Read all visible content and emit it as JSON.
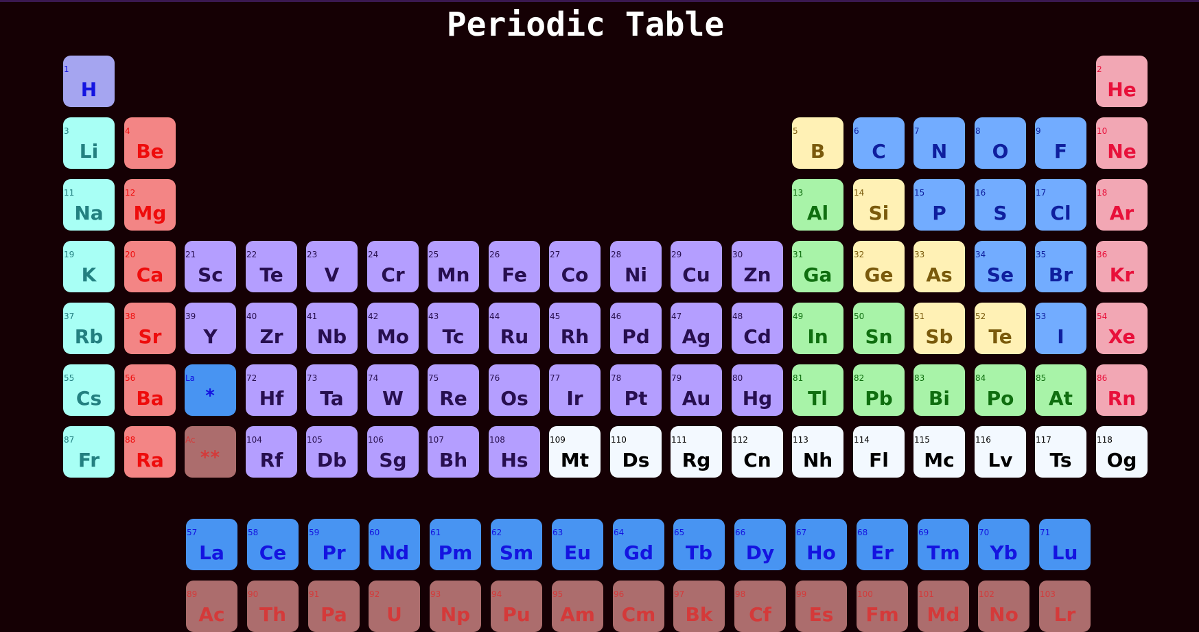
{
  "title": "Periodic Table",
  "colors": {
    "background": "#150004",
    "hydrogen": "#a5a5f0",
    "alkali_metal": "#a8fff5",
    "alkaline_earth": "#f38585",
    "noble_gas": "#f2a7b4",
    "transition_metal": "#b49eff",
    "post_transition_metal": "#a8f3a8",
    "metalloid": "#fff1b5",
    "nonmetal": "#72acff",
    "lanthanide": "#4894f2",
    "actinide": "#ac6d6d",
    "unknown": "#f3f9ff"
  },
  "elements": [
    {
      "n": "1",
      "s": "H",
      "c": "c-H",
      "g": 1,
      "r": 1
    },
    {
      "n": "2",
      "s": "He",
      "c": "c-ng",
      "g": 18,
      "r": 1
    },
    {
      "n": "3",
      "s": "Li",
      "c": "c-alk",
      "g": 1,
      "r": 2
    },
    {
      "n": "4",
      "s": "Be",
      "c": "c-ae",
      "g": 2,
      "r": 2
    },
    {
      "n": "5",
      "s": "B",
      "c": "c-mld",
      "g": 13,
      "r": 2
    },
    {
      "n": "6",
      "s": "C",
      "c": "c-nm",
      "g": 14,
      "r": 2
    },
    {
      "n": "7",
      "s": "N",
      "c": "c-nm",
      "g": 15,
      "r": 2
    },
    {
      "n": "8",
      "s": "O",
      "c": "c-nm",
      "g": 16,
      "r": 2
    },
    {
      "n": "9",
      "s": "F",
      "c": "c-nm",
      "g": 17,
      "r": 2
    },
    {
      "n": "10",
      "s": "Ne",
      "c": "c-ng",
      "g": 18,
      "r": 2
    },
    {
      "n": "11",
      "s": "Na",
      "c": "c-alk",
      "g": 1,
      "r": 3
    },
    {
      "n": "12",
      "s": "Mg",
      "c": "c-ae",
      "g": 2,
      "r": 3
    },
    {
      "n": "13",
      "s": "Al",
      "c": "c-met",
      "g": 13,
      "r": 3
    },
    {
      "n": "14",
      "s": "Si",
      "c": "c-mld",
      "g": 14,
      "r": 3
    },
    {
      "n": "15",
      "s": "P",
      "c": "c-nm",
      "g": 15,
      "r": 3
    },
    {
      "n": "16",
      "s": "S",
      "c": "c-nm",
      "g": 16,
      "r": 3
    },
    {
      "n": "17",
      "s": "Cl",
      "c": "c-nm",
      "g": 17,
      "r": 3
    },
    {
      "n": "18",
      "s": "Ar",
      "c": "c-ng",
      "g": 18,
      "r": 3
    },
    {
      "n": "19",
      "s": "K",
      "c": "c-alk",
      "g": 1,
      "r": 4
    },
    {
      "n": "20",
      "s": "Ca",
      "c": "c-ae",
      "g": 2,
      "r": 4
    },
    {
      "n": "21",
      "s": "Sc",
      "c": "c-tm",
      "g": 3,
      "r": 4
    },
    {
      "n": "22",
      "s": "Te",
      "c": "c-tm",
      "g": 4,
      "r": 4
    },
    {
      "n": "23",
      "s": "V",
      "c": "c-tm",
      "g": 5,
      "r": 4
    },
    {
      "n": "24",
      "s": "Cr",
      "c": "c-tm",
      "g": 6,
      "r": 4
    },
    {
      "n": "25",
      "s": "Mn",
      "c": "c-tm",
      "g": 7,
      "r": 4
    },
    {
      "n": "26",
      "s": "Fe",
      "c": "c-tm",
      "g": 8,
      "r": 4
    },
    {
      "n": "27",
      "s": "Co",
      "c": "c-tm",
      "g": 9,
      "r": 4
    },
    {
      "n": "28",
      "s": "Ni",
      "c": "c-tm",
      "g": 10,
      "r": 4
    },
    {
      "n": "29",
      "s": "Cu",
      "c": "c-tm",
      "g": 11,
      "r": 4
    },
    {
      "n": "30",
      "s": "Zn",
      "c": "c-tm",
      "g": 12,
      "r": 4
    },
    {
      "n": "31",
      "s": "Ga",
      "c": "c-met",
      "g": 13,
      "r": 4
    },
    {
      "n": "32",
      "s": "Ge",
      "c": "c-mld",
      "g": 14,
      "r": 4
    },
    {
      "n": "33",
      "s": "As",
      "c": "c-mld",
      "g": 15,
      "r": 4
    },
    {
      "n": "34",
      "s": "Se",
      "c": "c-nm",
      "g": 16,
      "r": 4
    },
    {
      "n": "35",
      "s": "Br",
      "c": "c-nm",
      "g": 17,
      "r": 4
    },
    {
      "n": "36",
      "s": "Kr",
      "c": "c-ng",
      "g": 18,
      "r": 4
    },
    {
      "n": "37",
      "s": "Rb",
      "c": "c-alk",
      "g": 1,
      "r": 5
    },
    {
      "n": "38",
      "s": "Sr",
      "c": "c-ae",
      "g": 2,
      "r": 5
    },
    {
      "n": "39",
      "s": "Y",
      "c": "c-tm",
      "g": 3,
      "r": 5
    },
    {
      "n": "40",
      "s": "Zr",
      "c": "c-tm",
      "g": 4,
      "r": 5
    },
    {
      "n": "41",
      "s": "Nb",
      "c": "c-tm",
      "g": 5,
      "r": 5
    },
    {
      "n": "42",
      "s": "Mo",
      "c": "c-tm",
      "g": 6,
      "r": 5
    },
    {
      "n": "43",
      "s": "Tc",
      "c": "c-tm",
      "g": 7,
      "r": 5
    },
    {
      "n": "44",
      "s": "Ru",
      "c": "c-tm",
      "g": 8,
      "r": 5
    },
    {
      "n": "45",
      "s": "Rh",
      "c": "c-tm",
      "g": 9,
      "r": 5
    },
    {
      "n": "46",
      "s": "Pd",
      "c": "c-tm",
      "g": 10,
      "r": 5
    },
    {
      "n": "47",
      "s": "Ag",
      "c": "c-tm",
      "g": 11,
      "r": 5
    },
    {
      "n": "48",
      "s": "Cd",
      "c": "c-tm",
      "g": 12,
      "r": 5
    },
    {
      "n": "49",
      "s": "In",
      "c": "c-met",
      "g": 13,
      "r": 5
    },
    {
      "n": "50",
      "s": "Sn",
      "c": "c-met",
      "g": 14,
      "r": 5
    },
    {
      "n": "51",
      "s": "Sb",
      "c": "c-mld",
      "g": 15,
      "r": 5
    },
    {
      "n": "52",
      "s": "Te",
      "c": "c-mld",
      "g": 16,
      "r": 5
    },
    {
      "n": "53",
      "s": "I",
      "c": "c-nm",
      "g": 17,
      "r": 5
    },
    {
      "n": "54",
      "s": "Xe",
      "c": "c-ng",
      "g": 18,
      "r": 5
    },
    {
      "n": "55",
      "s": "Cs",
      "c": "c-alk",
      "g": 1,
      "r": 6
    },
    {
      "n": "56",
      "s": "Ba",
      "c": "c-ae",
      "g": 2,
      "r": 6
    },
    {
      "n": "La",
      "s": "*",
      "c": "c-lan",
      "g": 3,
      "r": 6,
      "star": true
    },
    {
      "n": "72",
      "s": "Hf",
      "c": "c-tm",
      "g": 4,
      "r": 6
    },
    {
      "n": "73",
      "s": "Ta",
      "c": "c-tm",
      "g": 5,
      "r": 6
    },
    {
      "n": "74",
      "s": "W",
      "c": "c-tm",
      "g": 6,
      "r": 6
    },
    {
      "n": "75",
      "s": "Re",
      "c": "c-tm",
      "g": 7,
      "r": 6
    },
    {
      "n": "76",
      "s": "Os",
      "c": "c-tm",
      "g": 8,
      "r": 6
    },
    {
      "n": "77",
      "s": "Ir",
      "c": "c-tm",
      "g": 9,
      "r": 6
    },
    {
      "n": "78",
      "s": "Pt",
      "c": "c-tm",
      "g": 10,
      "r": 6
    },
    {
      "n": "79",
      "s": "Au",
      "c": "c-tm",
      "g": 11,
      "r": 6
    },
    {
      "n": "80",
      "s": "Hg",
      "c": "c-tm",
      "g": 12,
      "r": 6
    },
    {
      "n": "81",
      "s": "Tl",
      "c": "c-met",
      "g": 13,
      "r": 6
    },
    {
      "n": "82",
      "s": "Pb",
      "c": "c-met",
      "g": 14,
      "r": 6
    },
    {
      "n": "83",
      "s": "Bi",
      "c": "c-met",
      "g": 15,
      "r": 6
    },
    {
      "n": "84",
      "s": "Po",
      "c": "c-met",
      "g": 16,
      "r": 6
    },
    {
      "n": "85",
      "s": "At",
      "c": "c-met",
      "g": 17,
      "r": 6
    },
    {
      "n": "86",
      "s": "Rn",
      "c": "c-ng",
      "g": 18,
      "r": 6
    },
    {
      "n": "87",
      "s": "Fr",
      "c": "c-alk",
      "g": 1,
      "r": 7
    },
    {
      "n": "88",
      "s": "Ra",
      "c": "c-ae",
      "g": 2,
      "r": 7
    },
    {
      "n": "Ac",
      "s": "**",
      "c": "c-act",
      "g": 3,
      "r": 7,
      "star": true
    },
    {
      "n": "104",
      "s": "Rf",
      "c": "c-tm",
      "g": 4,
      "r": 7
    },
    {
      "n": "105",
      "s": "Db",
      "c": "c-tm",
      "g": 5,
      "r": 7
    },
    {
      "n": "106",
      "s": "Sg",
      "c": "c-tm",
      "g": 6,
      "r": 7
    },
    {
      "n": "107",
      "s": "Bh",
      "c": "c-tm",
      "g": 7,
      "r": 7
    },
    {
      "n": "108",
      "s": "Hs",
      "c": "c-tm",
      "g": 8,
      "r": 7
    },
    {
      "n": "109",
      "s": "Mt",
      "c": "c-unk",
      "g": 9,
      "r": 7
    },
    {
      "n": "110",
      "s": "Ds",
      "c": "c-unk",
      "g": 10,
      "r": 7
    },
    {
      "n": "111",
      "s": "Rg",
      "c": "c-unk",
      "g": 11,
      "r": 7
    },
    {
      "n": "112",
      "s": "Cn",
      "c": "c-unk",
      "g": 12,
      "r": 7
    },
    {
      "n": "113",
      "s": "Nh",
      "c": "c-unk",
      "g": 13,
      "r": 7
    },
    {
      "n": "114",
      "s": "Fl",
      "c": "c-unk",
      "g": 14,
      "r": 7
    },
    {
      "n": "115",
      "s": "Mc",
      "c": "c-unk",
      "g": 15,
      "r": 7
    },
    {
      "n": "116",
      "s": "Lv",
      "c": "c-unk",
      "g": 16,
      "r": 7
    },
    {
      "n": "117",
      "s": "Ts",
      "c": "c-unk",
      "g": 17,
      "r": 7
    },
    {
      "n": "118",
      "s": "Og",
      "c": "c-unk",
      "g": 18,
      "r": 7
    }
  ],
  "lanthanides": [
    {
      "n": "57",
      "s": "La"
    },
    {
      "n": "58",
      "s": "Ce"
    },
    {
      "n": "59",
      "s": "Pr"
    },
    {
      "n": "60",
      "s": "Nd"
    },
    {
      "n": "61",
      "s": "Pm"
    },
    {
      "n": "62",
      "s": "Sm"
    },
    {
      "n": "63",
      "s": "Eu"
    },
    {
      "n": "64",
      "s": "Gd"
    },
    {
      "n": "65",
      "s": "Tb"
    },
    {
      "n": "66",
      "s": "Dy"
    },
    {
      "n": "67",
      "s": "Ho"
    },
    {
      "n": "68",
      "s": "Er"
    },
    {
      "n": "69",
      "s": "Tm"
    },
    {
      "n": "70",
      "s": "Yb"
    },
    {
      "n": "71",
      "s": "Lu"
    }
  ],
  "actinides": [
    {
      "n": "89",
      "s": "Ac"
    },
    {
      "n": "90",
      "s": "Th"
    },
    {
      "n": "91",
      "s": "Pa"
    },
    {
      "n": "92",
      "s": "U"
    },
    {
      "n": "93",
      "s": "Np"
    },
    {
      "n": "94",
      "s": "Pu"
    },
    {
      "n": "95",
      "s": "Am"
    },
    {
      "n": "96",
      "s": "Cm"
    },
    {
      "n": "97",
      "s": "Bk"
    },
    {
      "n": "98",
      "s": "Cf"
    },
    {
      "n": "99",
      "s": "Es"
    },
    {
      "n": "100",
      "s": "Fm"
    },
    {
      "n": "101",
      "s": "Md"
    },
    {
      "n": "102",
      "s": "No"
    },
    {
      "n": "103",
      "s": "Lr"
    }
  ]
}
